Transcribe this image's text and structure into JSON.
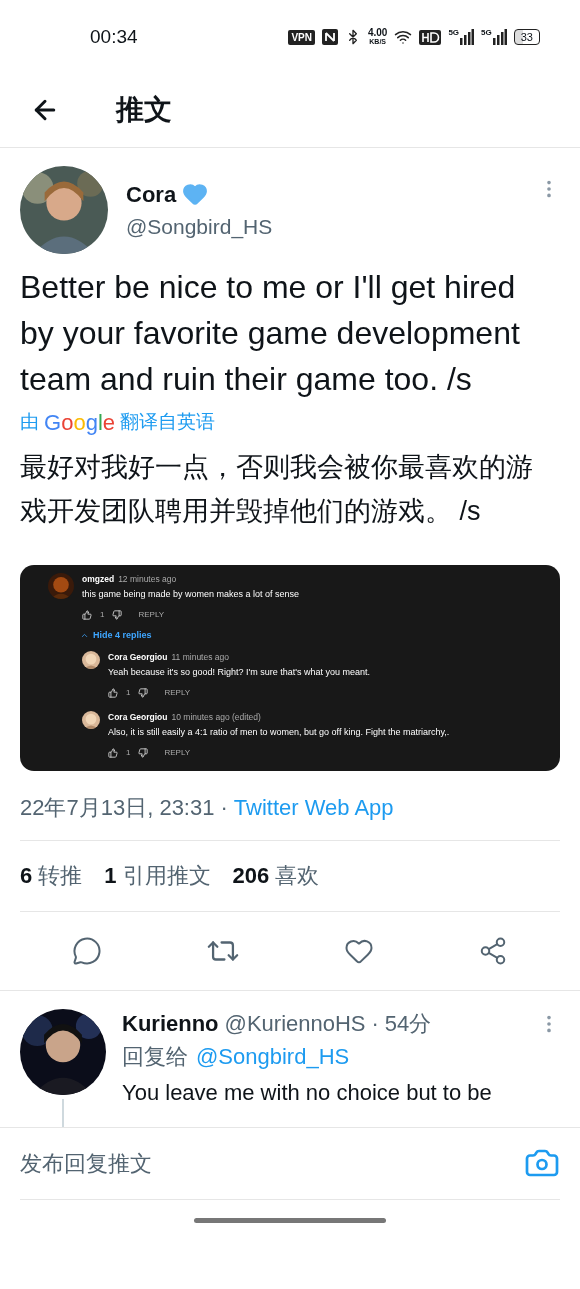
{
  "status_bar": {
    "time": "00:34",
    "vpn": "VPN",
    "speed_value": "4.00",
    "speed_unit": "KB/S",
    "network_1": "5G",
    "network_2": "5G",
    "battery": "33"
  },
  "header": {
    "title": "推文"
  },
  "tweet": {
    "name": "Cora",
    "handle": "@Songbird_HS",
    "verified": true,
    "text": "Better be nice to me or I'll get hired by your favorite game development team and ruin their game too. /s",
    "translation": {
      "prefix": "由",
      "brand": "Google",
      "suffix": "翻译自英语",
      "text": "最好对我好一点，否则我会被你最喜欢的游戏开发团队聘用并毁掉他们的游戏。 /s"
    },
    "embedded": {
      "comments": [
        {
          "author": "omgzed",
          "time": "12 minutes ago",
          "text": "this game being made by women makes a lot of sense",
          "likes": "1",
          "reply": "REPLY",
          "toggle": "Hide 4 replies",
          "expanded": true,
          "children": [
            {
              "author": "Cora Georgiou",
              "time": "11 minutes ago",
              "text": "Yeah because it's so good! Right? I'm sure that's what you meant.",
              "likes": "1",
              "reply": "REPLY"
            },
            {
              "author": "Cora Georgiou",
              "time": "10 minutes ago (edited)",
              "text": "Also, it is still easily a 4:1 ratio of men to women, but go off king. Fight the matriarchy,.",
              "likes": "1",
              "reply": "REPLY"
            }
          ]
        }
      ]
    },
    "date": "22年7月13日, 23:31",
    "separator": "·",
    "source": "Twitter Web App",
    "stats": [
      {
        "count": "6",
        "label": "转推"
      },
      {
        "count": "1",
        "label": "引用推文"
      },
      {
        "count": "206",
        "label": "喜欢"
      }
    ]
  },
  "reply": {
    "name": "Kurienno",
    "handle": "@KuriennoHS",
    "separator": "·",
    "time": "54分",
    "reply_to_label": "回复给",
    "reply_to": "@Songbird_HS",
    "text": "You leave me with no choice but to be"
  },
  "composer": {
    "placeholder": "发布回复推文"
  }
}
